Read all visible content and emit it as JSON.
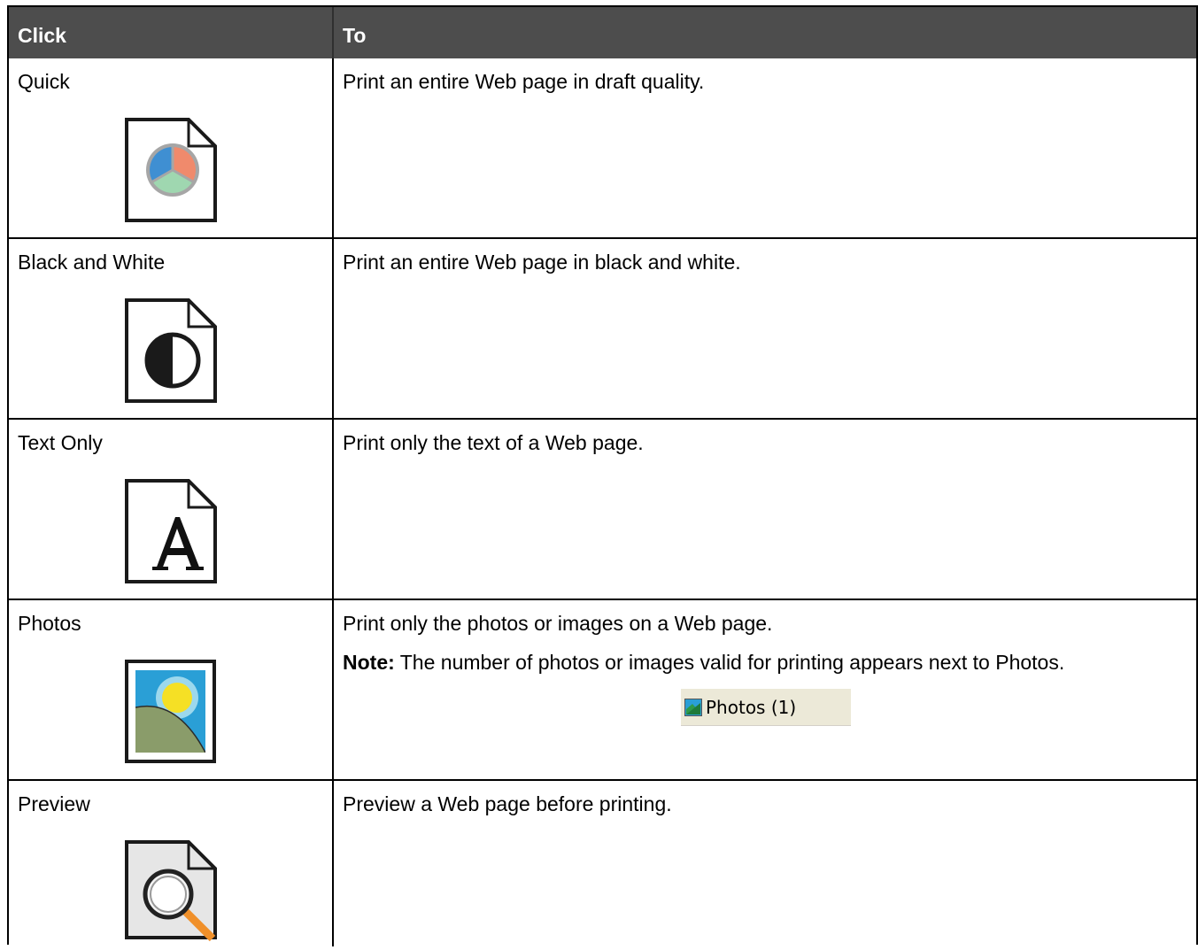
{
  "table": {
    "headers": {
      "click": "Click",
      "to": "To"
    },
    "rows": [
      {
        "label": "Quick",
        "icon": "quick-print-icon",
        "description": "Print an entire Web page in draft quality."
      },
      {
        "label": "Black and White",
        "icon": "black-and-white-print-icon",
        "description": "Print an entire Web page in black and white."
      },
      {
        "label": "Text Only",
        "icon": "text-only-print-icon",
        "description": "Print only the text of a Web page."
      },
      {
        "label": "Photos",
        "icon": "photos-print-icon",
        "description": "Print only the photos or images on a Web page.",
        "note_label": "Note:",
        "note_text": " The number of photos or images valid for printing appears next to Photos.",
        "button_label": "Photos (1)"
      },
      {
        "label": "Preview",
        "icon": "preview-magnifier-icon",
        "description": "Preview a Web page before printing."
      }
    ]
  },
  "colors": {
    "header_bg": "#4d4d4d",
    "pie_blue": "#3f8fd2",
    "pie_orange": "#f08a6c",
    "pie_green": "#9fd7b0",
    "magnifier_handle": "#f0902a",
    "photo_sky": "#2a9fd6",
    "photo_sun": "#f5e025",
    "photo_hill": "#8a9c6a"
  }
}
